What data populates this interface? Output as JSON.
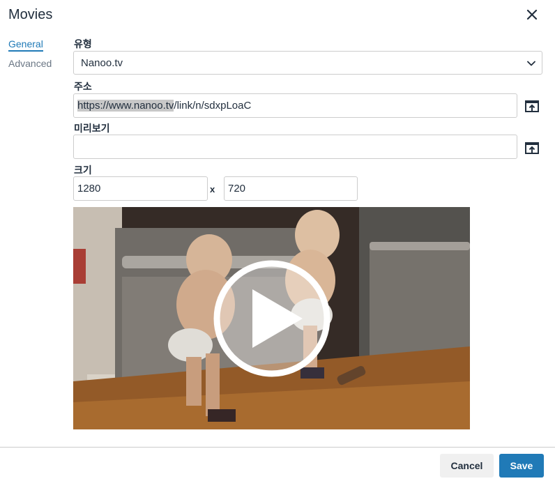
{
  "dialog": {
    "title": "Movies"
  },
  "tabs": [
    {
      "label": "General",
      "active": true
    },
    {
      "label": "Advanced",
      "active": false
    }
  ],
  "fields": {
    "type": {
      "label": "유형",
      "value": "Nanoo.tv"
    },
    "url": {
      "label": "주소",
      "value_selected": "https://www.nanoo.tv",
      "value_rest": "/link/n/sdxpLoaC"
    },
    "preview": {
      "label": "미리보기",
      "value": ""
    },
    "size": {
      "label": "크기",
      "width": "1280",
      "separator": "x",
      "height": "720"
    }
  },
  "buttons": {
    "cancel": "Cancel",
    "save": "Save"
  },
  "colors": {
    "accent": "#207ab7",
    "text": "#222f3e",
    "border": "#cccccc"
  },
  "icons": [
    "close-icon",
    "chevron-down-icon",
    "browse-icon",
    "play-icon"
  ]
}
